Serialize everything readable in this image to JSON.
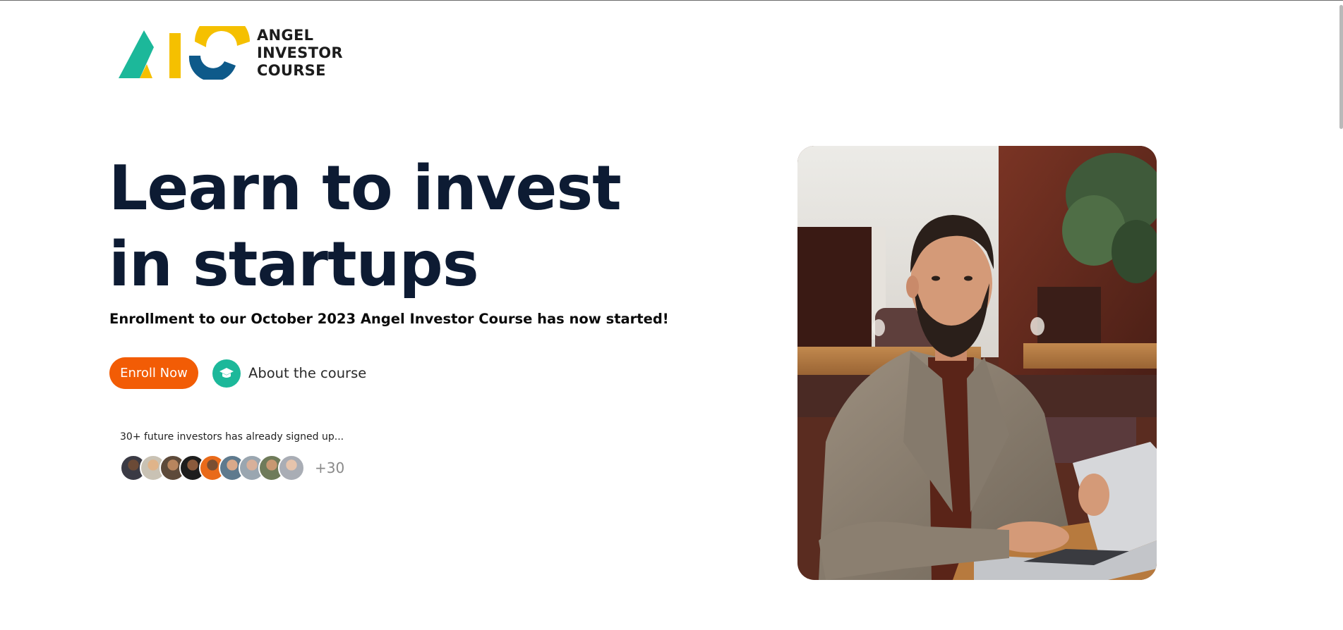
{
  "logo": {
    "mark_letters": "AIC",
    "lines": [
      "ANGEL",
      "INVESTOR",
      "COURSE"
    ],
    "colors": {
      "teal": "#1cb89a",
      "yellow": "#f5c000",
      "navy": "#0e5a8a"
    }
  },
  "hero": {
    "title_line1": "Learn to invest",
    "title_line2": "in startups",
    "subtitle": "Enrollment to our October 2023 Angel Investor Course has now started!",
    "enroll_label": "Enroll Now",
    "about_label": "About the course",
    "about_icon": "graduation-cap-icon"
  },
  "social_proof": {
    "text": "30+ future investors has already signed up...",
    "avatar_count": 9,
    "more_label": "+30"
  },
  "photo": {
    "description_icon": "hero-photo"
  },
  "colors": {
    "accent_orange": "#f25c05",
    "accent_teal": "#1cb89a",
    "title_navy": "#0d1b33"
  }
}
